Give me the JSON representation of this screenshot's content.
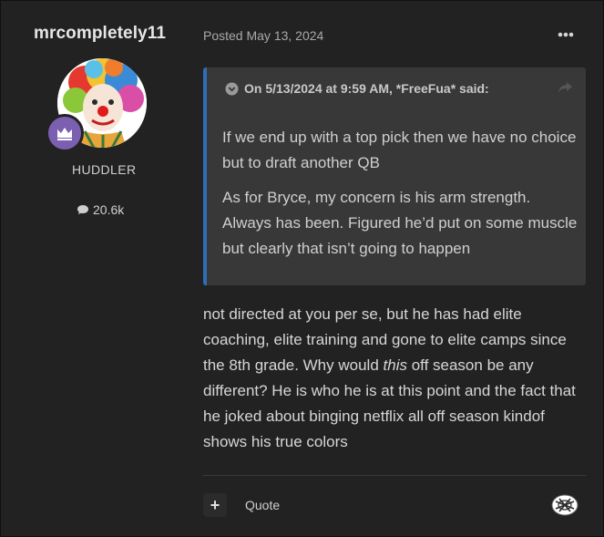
{
  "author": {
    "name": "mrcompletely11",
    "member_title": "HUDDLER",
    "post_count": "20.6k",
    "rank_color": "#7b5fb0"
  },
  "post": {
    "date_label": "Posted May 13, 2024",
    "menu_icon": "ellipsis-icon",
    "body_part1": "not directed at you per se, but he has had elite coaching, elite training and gone to elite camps since the 8th grade.  Why would ",
    "body_emphasis": "this",
    "body_part2": " off season be any different?  He is who he is at this point and the fact that he joked about binging netflix all off season kindof shows his true colors"
  },
  "quote": {
    "header": "On 5/13/2024 at 9:59 AM, *FreeFua* said:",
    "paragraphs": [
      "If we end up with a top pick then we have no choice but to draft another QB",
      "As for Bryce, my concern is his arm strength. Always has been. Figured he’d put on some muscle but clearly that isn’t going to happen"
    ],
    "accent_color": "#2f6db5"
  },
  "footer": {
    "plus_label": "+",
    "quote_label": "Quote",
    "reaction_icon": "reaction-icon"
  }
}
